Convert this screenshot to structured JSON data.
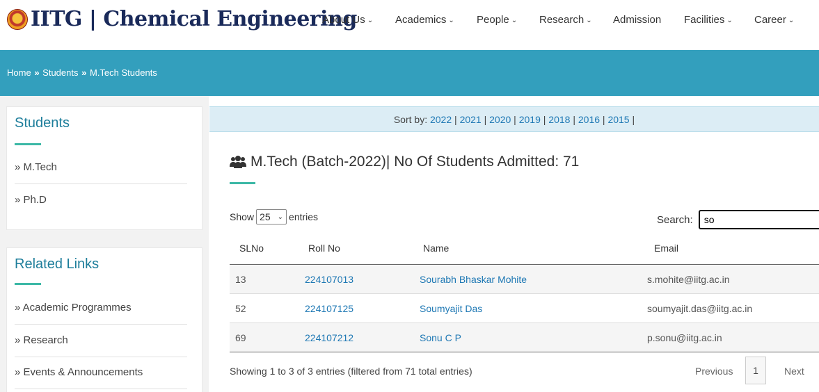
{
  "header": {
    "logo_text": "IITG | Chemical Engineering",
    "nav": [
      {
        "label": "About Us",
        "dropdown": true
      },
      {
        "label": "Academics",
        "dropdown": true
      },
      {
        "label": "People",
        "dropdown": true
      },
      {
        "label": "Research",
        "dropdown": true
      },
      {
        "label": "Admission",
        "dropdown": false
      },
      {
        "label": "Facilities",
        "dropdown": true
      },
      {
        "label": "Career",
        "dropdown": true
      }
    ]
  },
  "breadcrumb": {
    "items": [
      "Home",
      "Students",
      "M.Tech Students"
    ],
    "separator": "»"
  },
  "sidebar": {
    "students": {
      "title": "Students",
      "links": [
        "» M.Tech",
        "» Ph.D"
      ]
    },
    "related": {
      "title": "Related Links",
      "links": [
        "» Academic Programmes",
        "» Research",
        "» Events & Announcements"
      ]
    }
  },
  "sortbar": {
    "label": "Sort by:",
    "years": [
      "2022",
      "2021",
      "2020",
      "2019",
      "2018",
      "2016",
      "2015"
    ]
  },
  "main": {
    "heading": "M.Tech (Batch-2022)| No Of Students Admitted: 71",
    "icon": "users-icon"
  },
  "table_controls": {
    "show_label": "Show",
    "entries_value": "25",
    "entries_label": "entries",
    "search_label": "Search:",
    "search_value": "so"
  },
  "table": {
    "headers": [
      "SLNo",
      "Roll No",
      "Name",
      "Email"
    ],
    "rows": [
      {
        "sl": "13",
        "roll": "224107013",
        "name": "Sourabh Bhaskar Mohite",
        "email": "s.mohite@iitg.ac.in"
      },
      {
        "sl": "52",
        "roll": "224107125",
        "name": "Soumyajit Das",
        "email": "soumyajit.das@iitg.ac.in"
      },
      {
        "sl": "69",
        "roll": "224107212",
        "name": "Sonu C P",
        "email": "p.sonu@iitg.ac.in"
      }
    ]
  },
  "footer": {
    "info": "Showing 1 to 3 of 3 entries (filtered from 71 total entries)",
    "prev": "Previous",
    "page": "1",
    "next": "Next"
  },
  "colors": {
    "accent_bar": "#339fbd",
    "link": "#1e78b4",
    "accent_line": "#3cb8a6"
  }
}
